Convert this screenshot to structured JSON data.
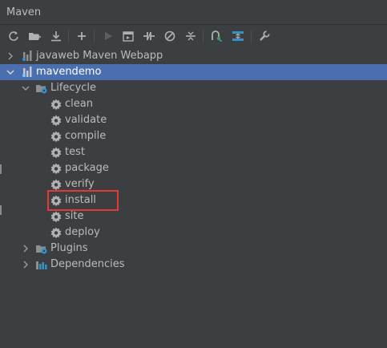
{
  "window": {
    "title": "Maven"
  },
  "toolbar": {
    "buttons": [
      {
        "name": "reload-icon",
        "enabled": true
      },
      {
        "name": "add-maven-project-icon",
        "enabled": true
      },
      {
        "name": "download-sources-icon",
        "enabled": true
      },
      {
        "name": "add-icon",
        "enabled": true
      },
      {
        "name": "run-icon",
        "enabled": false
      },
      {
        "name": "execute-goal-icon",
        "enabled": true
      },
      {
        "name": "toggle-offline-icon",
        "enabled": true
      },
      {
        "name": "skip-tests-icon",
        "enabled": true
      },
      {
        "name": "collapse-all-icon",
        "enabled": true
      },
      {
        "name": "show-dependencies-icon",
        "enabled": true
      },
      {
        "name": "expand-all-icon",
        "enabled": true
      },
      {
        "name": "settings-wrench-icon",
        "enabled": true
      }
    ]
  },
  "tree": {
    "projects": [
      {
        "label": "javaweb Maven Webapp",
        "expanded": false,
        "selected": false
      },
      {
        "label": "mavendemo",
        "expanded": true,
        "selected": true
      }
    ],
    "lifecycle": {
      "label": "Lifecycle",
      "goals": [
        "clean",
        "validate",
        "compile",
        "test",
        "package",
        "verify",
        "install",
        "site",
        "deploy"
      ]
    },
    "plugins": {
      "label": "Plugins"
    },
    "dependencies": {
      "label": "Dependencies"
    }
  },
  "colors": {
    "background": "#3c3f41",
    "selection": "#4b6eaf",
    "text": "#bbbbbb",
    "highlight_box": "#e53935"
  },
  "annotation": {
    "highlighted_goal": "install"
  }
}
